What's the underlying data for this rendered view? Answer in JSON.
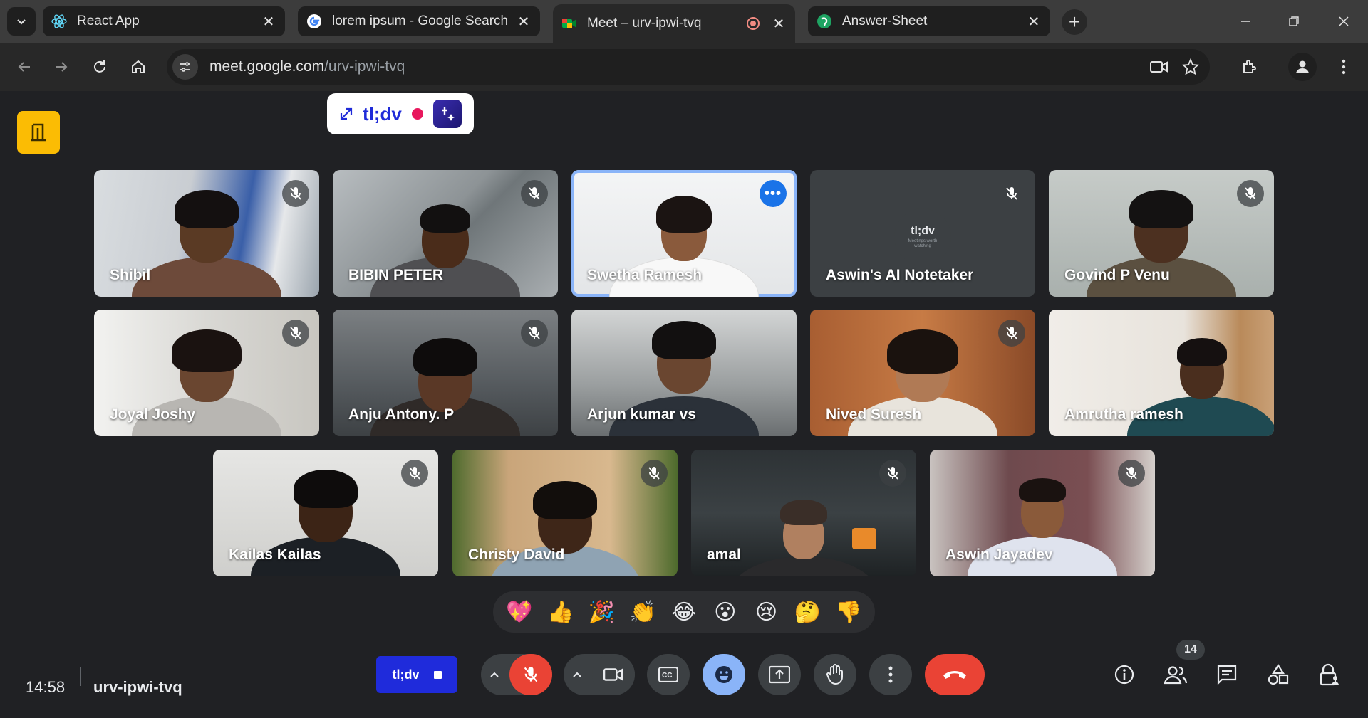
{
  "browser": {
    "tabs": [
      {
        "title": "React App",
        "icon": "react-icon"
      },
      {
        "title": "lorem ipsum - Google Search",
        "icon": "google-icon"
      },
      {
        "title": "Meet – urv-ipwi-tvq",
        "icon": "meet-icon",
        "active": true,
        "recording": true
      },
      {
        "title": "Answer-Sheet",
        "icon": "answer-sheet-icon"
      }
    ],
    "url_host": "meet.google.com",
    "url_path": "/urv-ipwi-tvq"
  },
  "tldv": {
    "brand": "tl;dv",
    "button_label": "tl;dv"
  },
  "participants": [
    {
      "name": "Shibil",
      "muted": true,
      "speaking": false
    },
    {
      "name": "BIBIN PETER",
      "muted": true,
      "speaking": false
    },
    {
      "name": "Swetha Ramesh",
      "muted": false,
      "speaking": true
    },
    {
      "name": "Aswin's AI Notetaker",
      "muted": true,
      "speaking": false,
      "avatar_title": "tl;dv",
      "avatar_subtitle": "Meetings worth watching"
    },
    {
      "name": "Govind P Venu",
      "muted": true,
      "speaking": false
    },
    {
      "name": "Joyal Joshy",
      "muted": true,
      "speaking": false
    },
    {
      "name": "Anju Antony. P",
      "muted": true,
      "speaking": false
    },
    {
      "name": "Arjun kumar vs",
      "muted": false,
      "speaking": false
    },
    {
      "name": "Nived Suresh",
      "muted": true,
      "speaking": false
    },
    {
      "name": "Amrutha ramesh",
      "muted": false,
      "speaking": false
    },
    {
      "name": "Kailas Kailas",
      "muted": true,
      "speaking": false
    },
    {
      "name": "Christy David",
      "muted": true,
      "speaking": false
    },
    {
      "name": "amal",
      "muted": true,
      "speaking": false
    },
    {
      "name": "Aswin Jayadev",
      "muted": true,
      "speaking": false
    }
  ],
  "reactions": [
    "💖",
    "👍",
    "🎉",
    "👏",
    "😂",
    "😮",
    "😢",
    "🤔",
    "👎"
  ],
  "bottom": {
    "time": "14:58",
    "meeting_code": "urv-ipwi-tvq",
    "participant_count": "14"
  },
  "colors": {
    "background": "#202124",
    "end_call": "#ea4335",
    "exit_button": "#fbbc04",
    "tldv_blue": "#1f2bdb",
    "speaking_border": "#8ab4f8",
    "emoji_button": "#8ab4f8"
  }
}
